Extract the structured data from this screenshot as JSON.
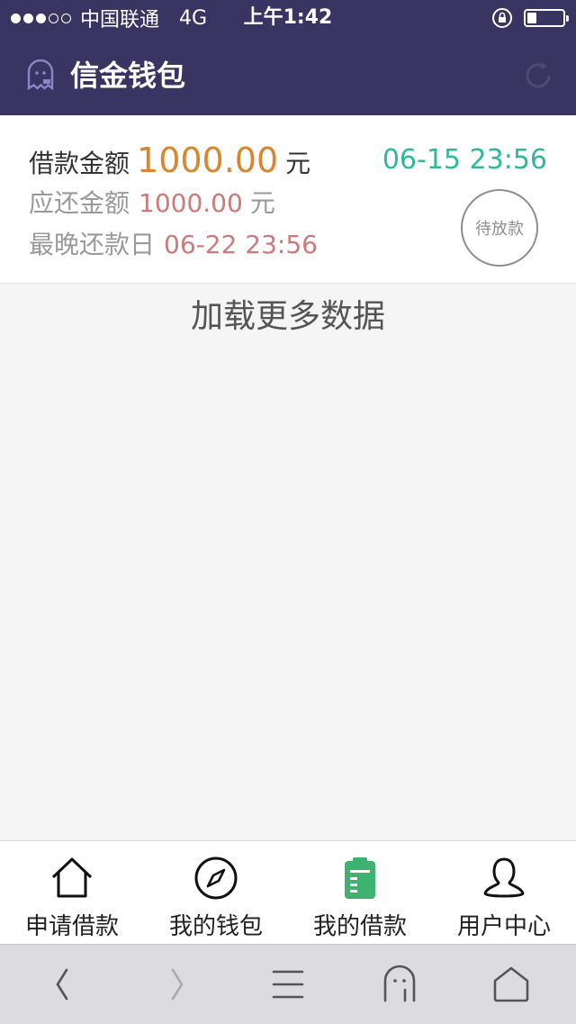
{
  "status_bar": {
    "carrier": "中国联通",
    "network": "4G",
    "time": "上午1:42",
    "battery_level": 0.25
  },
  "header": {
    "title": "信金钱包",
    "icons": {
      "logo": "ghost-icon",
      "refresh": "refresh-icon"
    }
  },
  "loan": {
    "amount_label": "借款金额",
    "amount": "1000.00",
    "unit": "元",
    "due_label": "应还金额",
    "due_amount": "1000.00",
    "due_unit": "元",
    "deadline_label": "最晚还款日",
    "deadline": "06-22 23:56",
    "date": "06-15 23:56",
    "status": "待放款"
  },
  "load_more": "加载更多数据",
  "tabs": [
    {
      "label": "申请借款",
      "icon": "home-icon",
      "active": false
    },
    {
      "label": "我的钱包",
      "icon": "compass-icon",
      "active": false
    },
    {
      "label": "我的借款",
      "icon": "clipboard-icon",
      "active": true
    },
    {
      "label": "用户中心",
      "icon": "user-icon",
      "active": false
    }
  ],
  "browser_bar": {
    "icons": [
      "back-icon",
      "forward-icon",
      "menu-icon",
      "ghost-icon",
      "home-icon"
    ]
  },
  "colors": {
    "header_bg": "#3a3463",
    "amount": "#d9862c",
    "date": "#2fb99b",
    "red_value": "#cc7a7a",
    "active_tab": "#3cb371"
  }
}
